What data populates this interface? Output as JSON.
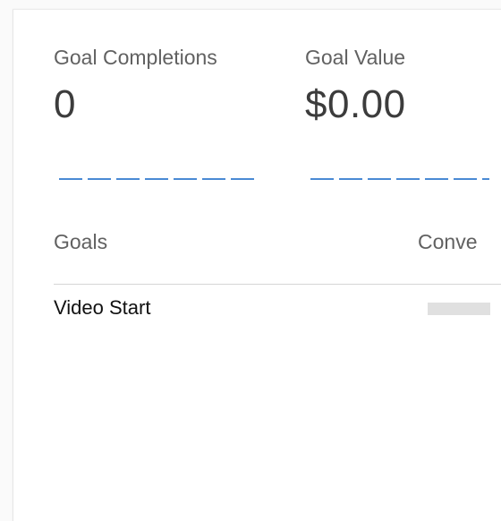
{
  "metrics": [
    {
      "label": "Goal Completions",
      "value": "0"
    },
    {
      "label": "Goal Value",
      "value": "$0.00"
    }
  ],
  "table": {
    "header_goals": "Goals",
    "header_conversions": "Conve",
    "rows": [
      {
        "name": "Video Start",
        "conversion_fraction": 0
      }
    ]
  },
  "colors": {
    "sparkline": "#4a8ad4",
    "bar": "#e0e0e0",
    "divider": "#d6d6d6"
  }
}
